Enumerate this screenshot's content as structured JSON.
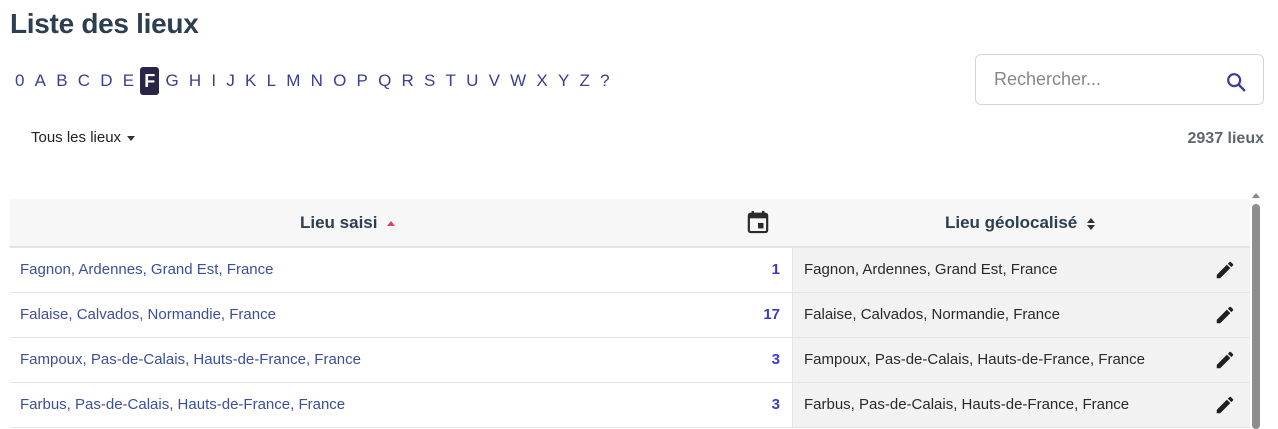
{
  "page": {
    "title": "Liste des lieux"
  },
  "alphabet": {
    "letters": [
      "0",
      "A",
      "B",
      "C",
      "D",
      "E",
      "F",
      "G",
      "H",
      "I",
      "J",
      "K",
      "L",
      "M",
      "N",
      "O",
      "P",
      "Q",
      "R",
      "S",
      "T",
      "U",
      "V",
      "W",
      "X",
      "Y",
      "Z",
      "?"
    ],
    "active": "F"
  },
  "search": {
    "placeholder": "Rechercher...",
    "icon": "search-icon"
  },
  "filter": {
    "label": "Tous les lieux"
  },
  "summary": {
    "count_text": "2937 lieux"
  },
  "table": {
    "headers": {
      "entered": "Lieu saisi",
      "date_icon": "calendar-icon",
      "geolocated": "Lieu géolocalisé"
    },
    "rows": [
      {
        "entered": "Fagnon, Ardennes, Grand Est, France",
        "count": "1",
        "geolocated": "Fagnon, Ardennes, Grand Est, France"
      },
      {
        "entered": "Falaise, Calvados, Normandie, France",
        "count": "17",
        "geolocated": "Falaise, Calvados, Normandie, France"
      },
      {
        "entered": "Fampoux, Pas-de-Calais, Hauts-de-France, France",
        "count": "3",
        "geolocated": "Fampoux, Pas-de-Calais, Hauts-de-France, France"
      },
      {
        "entered": "Farbus, Pas-de-Calais, Hauts-de-France, France",
        "count": "3",
        "geolocated": "Farbus, Pas-de-Calais, Hauts-de-France, France"
      }
    ]
  },
  "colors": {
    "accent": "#2a2547",
    "link": "#3b4f9b",
    "count": "#3b3bc7",
    "sort_active": "#e0415a"
  }
}
